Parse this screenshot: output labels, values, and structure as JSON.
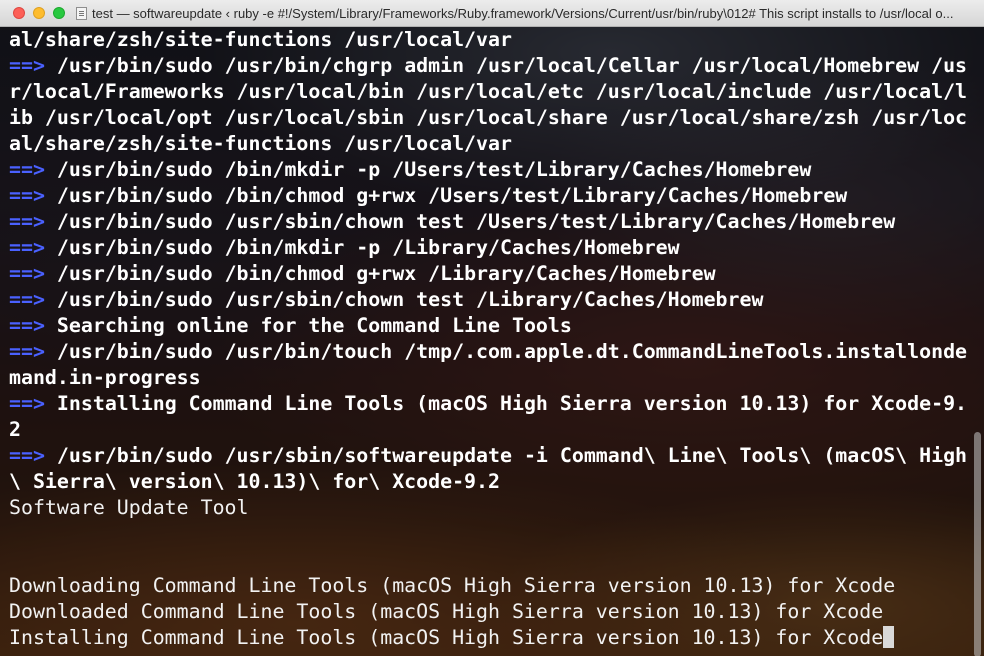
{
  "window": {
    "title": "test — softwareupdate ‹ ruby -e #!/System/Library/Frameworks/Ruby.framework/Versions/Current/usr/bin/ruby\\012# This script installs to /usr/local o..."
  },
  "colors": {
    "arrow": "#4a61ff",
    "text": "#ffffff",
    "titlebar": "#e3e3e3"
  },
  "terminal": {
    "lines": [
      {
        "arrow": "",
        "text": "al/share/zsh/site-functions /usr/local/var",
        "style": "bold"
      },
      {
        "arrow": "==>",
        "text": " /usr/bin/sudo /usr/bin/chgrp admin /usr/local/Cellar /usr/local/Homebrew /us",
        "style": "bold"
      },
      {
        "arrow": "",
        "text": "r/local/Frameworks /usr/local/bin /usr/local/etc /usr/local/include /usr/local/l",
        "style": "bold"
      },
      {
        "arrow": "",
        "text": "ib /usr/local/opt /usr/local/sbin /usr/local/share /usr/local/share/zsh /usr/loc",
        "style": "bold"
      },
      {
        "arrow": "",
        "text": "al/share/zsh/site-functions /usr/local/var",
        "style": "bold"
      },
      {
        "arrow": "==>",
        "text": " /usr/bin/sudo /bin/mkdir -p /Users/test/Library/Caches/Homebrew",
        "style": "bold"
      },
      {
        "arrow": "==>",
        "text": " /usr/bin/sudo /bin/chmod g+rwx /Users/test/Library/Caches/Homebrew",
        "style": "bold"
      },
      {
        "arrow": "==>",
        "text": " /usr/bin/sudo /usr/sbin/chown test /Users/test/Library/Caches/Homebrew",
        "style": "bold"
      },
      {
        "arrow": "==>",
        "text": " /usr/bin/sudo /bin/mkdir -p /Library/Caches/Homebrew",
        "style": "bold"
      },
      {
        "arrow": "==>",
        "text": " /usr/bin/sudo /bin/chmod g+rwx /Library/Caches/Homebrew",
        "style": "bold"
      },
      {
        "arrow": "==>",
        "text": " /usr/bin/sudo /usr/sbin/chown test /Library/Caches/Homebrew",
        "style": "bold"
      },
      {
        "arrow": "==>",
        "text": " Searching online for the Command Line Tools",
        "style": "bold"
      },
      {
        "arrow": "==>",
        "text": " /usr/bin/sudo /usr/bin/touch /tmp/.com.apple.dt.CommandLineTools.installonde",
        "style": "bold"
      },
      {
        "arrow": "",
        "text": "mand.in-progress",
        "style": "bold"
      },
      {
        "arrow": "==>",
        "text": " Installing Command Line Tools (macOS High Sierra version 10.13) for Xcode-9.",
        "style": "bold"
      },
      {
        "arrow": "",
        "text": "2",
        "style": "bold"
      },
      {
        "arrow": "==>",
        "text": " /usr/bin/sudo /usr/sbin/softwareupdate -i Command\\ Line\\ Tools\\ (macOS\\ High",
        "style": "bold"
      },
      {
        "arrow": "",
        "text": "\\ Sierra\\ version\\ 10.13)\\ for\\ Xcode-9.2",
        "style": "bold"
      },
      {
        "arrow": "",
        "text": "Software Update Tool",
        "style": "plain"
      },
      {
        "arrow": "",
        "text": "",
        "style": "plain"
      },
      {
        "arrow": "",
        "text": "",
        "style": "plain"
      },
      {
        "arrow": "",
        "text": "Downloading Command Line Tools (macOS High Sierra version 10.13) for Xcode",
        "style": "plain"
      },
      {
        "arrow": "",
        "text": "Downloaded Command Line Tools (macOS High Sierra version 10.13) for Xcode",
        "style": "plain"
      },
      {
        "arrow": "",
        "text": "Installing Command Line Tools (macOS High Sierra version 10.13) for Xcode",
        "style": "plain",
        "cursor": true
      }
    ]
  }
}
